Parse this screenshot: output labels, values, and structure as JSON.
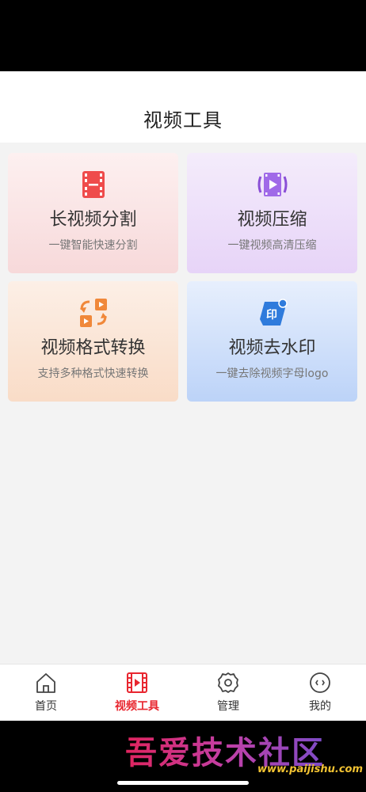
{
  "header": {
    "title": "视频工具"
  },
  "cards": [
    {
      "title": "长视频分割",
      "desc": "一键智能快速分割",
      "icon": "film-split-icon"
    },
    {
      "title": "视频压缩",
      "desc": "一键视频高清压缩",
      "icon": "video-compress-icon"
    },
    {
      "title": "视频格式转换",
      "desc": "支持多种格式快速转换",
      "icon": "format-convert-icon"
    },
    {
      "title": "视频去水印",
      "desc": "一键去除视频字母logo",
      "icon": "watermark-remove-icon"
    }
  ],
  "tabs": [
    {
      "label": "首页",
      "icon": "home-icon",
      "active": false
    },
    {
      "label": "视频工具",
      "icon": "film-icon",
      "active": true
    },
    {
      "label": "管理",
      "icon": "gear-icon",
      "active": false
    },
    {
      "label": "我的",
      "icon": "profile-icon",
      "active": false
    }
  ],
  "watermark": {
    "text": "吾爱技术社区",
    "url": "www.paijishu.com"
  },
  "colors": {
    "accent": "#e8262f",
    "compress": "#8a4fd6",
    "convert": "#f0883a",
    "watermark_icon": "#2f7bdc"
  }
}
